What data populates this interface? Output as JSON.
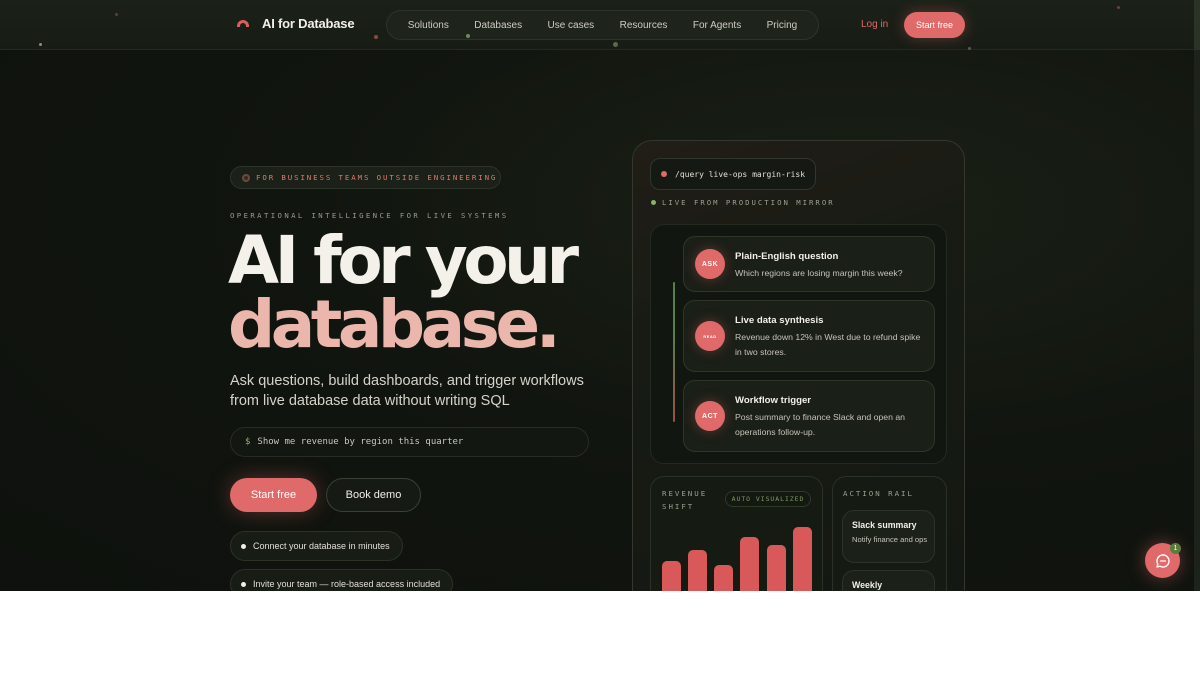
{
  "nav": {
    "brand": "AI for Database",
    "links": [
      "Solutions",
      "Databases",
      "Use cases",
      "Resources",
      "For Agents",
      "Pricing"
    ],
    "login": "Log in",
    "cta": "Start free"
  },
  "hero": {
    "badge": "FOR BUSINESS TEAMS OUTSIDE ENGINEERING",
    "eyebrow": "OPERATIONAL INTELLIGENCE FOR LIVE SYSTEMS",
    "title_line1": "AI for your",
    "title_line2": "database.",
    "subhead": "Ask questions, build dashboards, and trigger workflows from live database data without writing SQL",
    "command_prompt": "$",
    "command_text": "Show me revenue by region this quarter",
    "primary_cta": "Start free",
    "secondary_cta": "Book demo",
    "features": [
      "Connect your database in minutes",
      "Invite your team — role-based access included"
    ]
  },
  "panel": {
    "query": "/query live-ops margin-risk",
    "live_label": "LIVE FROM PRODUCTION MIRROR",
    "steps": [
      {
        "badge": "ASK",
        "title": "Plain-English question",
        "body": "Which regions are losing margin this week?"
      },
      {
        "badge": "READ",
        "title": "Live data synthesis",
        "body": "Revenue down 12% in West due to refund spike in two stores."
      },
      {
        "badge": "ACT",
        "title": "Workflow trigger",
        "body": "Post summary to finance Slack and open an operations follow-up."
      }
    ],
    "revenue_card": {
      "label_line1": "REVENUE",
      "label_line2": "SHIFT",
      "pill": "AUTO VISUALIZED"
    },
    "action_rail": {
      "label": "ACTION RAIL",
      "items": [
        {
          "title": "Slack summary",
          "body": "Notify finance and ops"
        },
        {
          "title": "Weekly",
          "body": ""
        }
      ]
    }
  },
  "chat": {
    "badge_count": "1"
  },
  "colors": {
    "accent": "#e06a6a",
    "background": "#11150f",
    "title_accent": "#ebb7ad",
    "live_green": "#8bb06c"
  }
}
